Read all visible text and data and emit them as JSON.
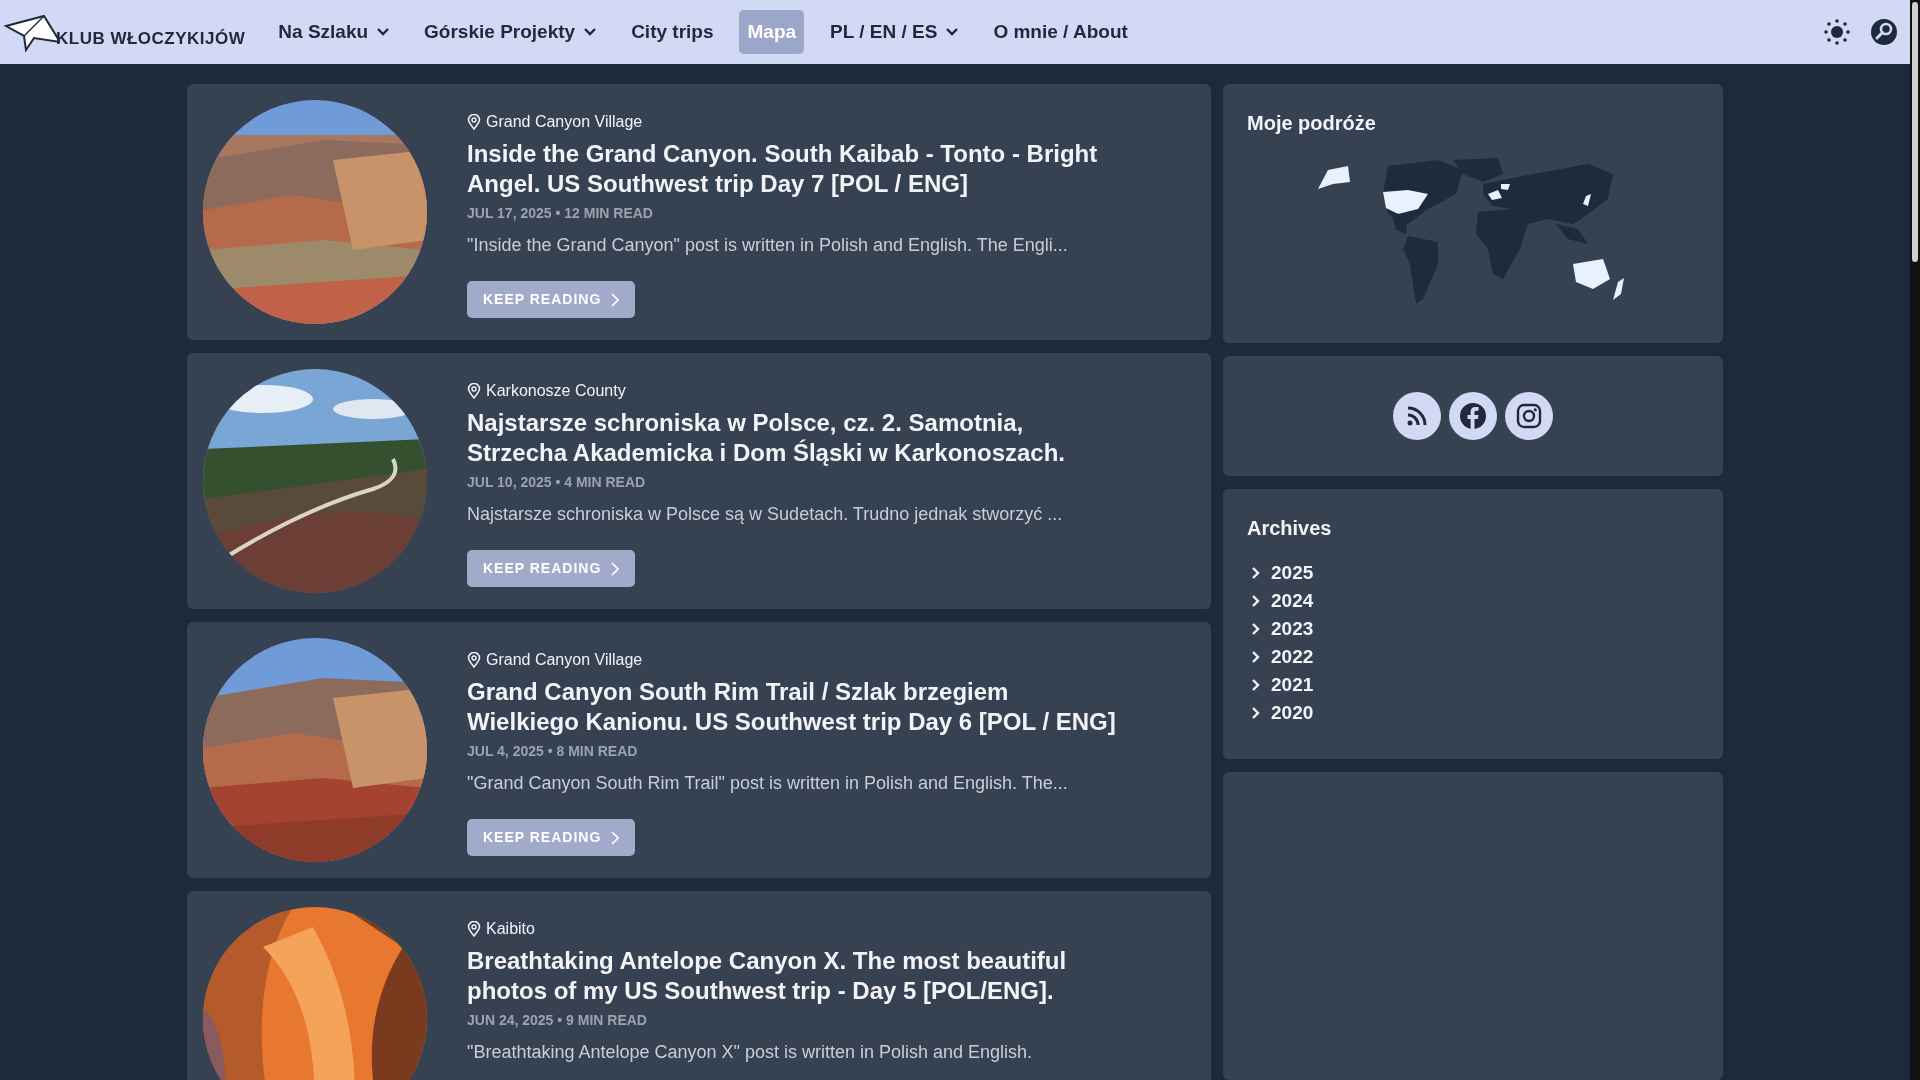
{
  "brand": {
    "name": "KLUB WŁOCZYKIJÓW"
  },
  "nav": [
    {
      "label": "Na Szlaku",
      "kind": "dropdown",
      "selected": false
    },
    {
      "label": "Górskie Projekty",
      "kind": "dropdown",
      "selected": false
    },
    {
      "label": "City trips",
      "kind": "link",
      "selected": false
    },
    {
      "label": "Mapa",
      "kind": "link",
      "selected": true
    },
    {
      "label": "PL / EN / ES",
      "kind": "dropdown",
      "selected": false
    },
    {
      "label": "O mnie / About",
      "kind": "link",
      "selected": false
    }
  ],
  "posts": [
    {
      "location": "Grand Canyon Village",
      "title": "Inside the Grand Canyon. South Kaibab - Tonto - Bright Angel. US Southwest trip Day 7 [POL / ENG]",
      "meta": "JUL 17, 2025 • 12 MIN READ",
      "excerpt": "\"Inside the Grand Canyon\" post is written in Polish and English. The Engli...",
      "button": "KEEP READING"
    },
    {
      "location": "Karkonosze County",
      "title": "Najstarsze schroniska w Polsce, cz. 2. Samotnia, Strzecha Akademicka i Dom Śląski w Karkonoszach.",
      "meta": "JUL 10, 2025 • 4 MIN READ",
      "excerpt": "Najstarsze schroniska w Polsce są w Sudetach. Trudno jednak stworzyć ...",
      "button": "KEEP READING"
    },
    {
      "location": "Grand Canyon Village",
      "title": "Grand Canyon South Rim Trail / Szlak brzegiem Wielkiego Kanionu. US Southwest trip Day 6 [POL / ENG]",
      "meta": "JUL 4, 2025 • 8 MIN READ",
      "excerpt": "\"Grand Canyon South Rim Trail\" post is written in Polish and English. The...",
      "button": "KEEP READING"
    },
    {
      "location": "Kaibito",
      "title": "Breathtaking Antelope Canyon X. The most beautiful photos of my US Southwest trip - Day 5 [POL/ENG].",
      "meta": "JUN 24, 2025 • 9 MIN READ",
      "excerpt": "\"Breathtaking Antelope Canyon X\" post is written in Polish and English."
    }
  ],
  "map_card": {
    "title": "Moje podróże"
  },
  "archives": {
    "title": "Archives",
    "years": [
      {
        "label": "2025",
        "expanded": false
      },
      {
        "label": "2024",
        "expanded": false
      },
      {
        "label": "2023",
        "expanded": false
      },
      {
        "label": "2022",
        "expanded": false
      },
      {
        "label": "2021",
        "expanded": false
      },
      {
        "label": "2020",
        "expanded": false
      }
    ]
  }
}
